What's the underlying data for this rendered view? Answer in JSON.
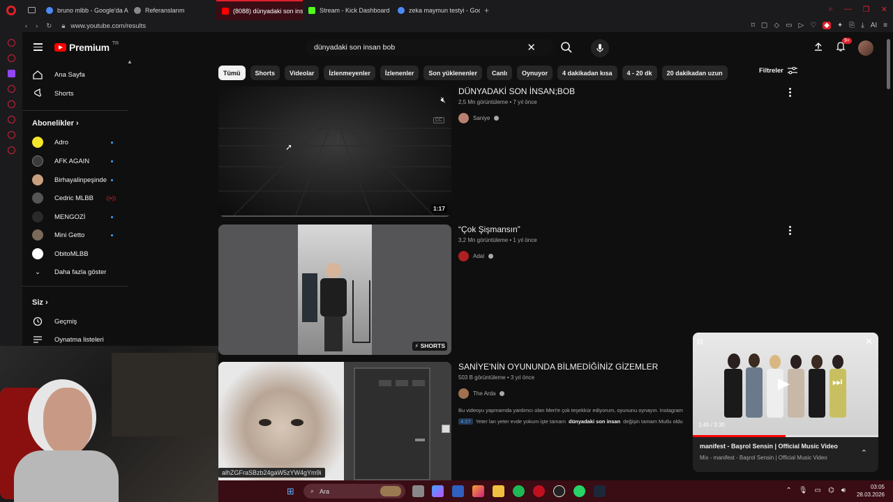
{
  "browser": {
    "tabs": [
      {
        "label": "bruno mlbb - Google'da A",
        "color": "#4a8af4",
        "active": false
      },
      {
        "label": "Referanslarım",
        "color": "#bbbbbb",
        "active": false
      },
      {
        "label": "(8088) dünyadaki son insa",
        "color": "#ff0000",
        "active": true
      },
      {
        "label": "Stream - Kick Dashboard",
        "color": "#53fc18",
        "active": false
      },
      {
        "label": "zeka maymun testyi - Goo",
        "color": "#4a8af4",
        "active": false
      }
    ],
    "new_tab": "+",
    "url": "www.youtube.com/results"
  },
  "yt": {
    "logo_text": "Premium",
    "logo_region": "TR",
    "search_value": "dünyadaki son insan bob",
    "notif_badge": "9+"
  },
  "sidebar": {
    "items_main": [
      {
        "label": "Ana Sayfa",
        "icon": "home-icon"
      },
      {
        "label": "Shorts",
        "icon": "shorts-icon"
      }
    ],
    "subs_title": "Abonelikler",
    "subs": [
      {
        "label": "Adro",
        "color": "#f5e62a",
        "state": "dot"
      },
      {
        "label": "AFK AGAIN",
        "color": "#3b3b3b",
        "state": "dot"
      },
      {
        "label": "Birhayalinpeşinde",
        "color": "#c8a080",
        "state": "dot"
      },
      {
        "label": "Cedric MLBB",
        "color": "#555555",
        "state": "live"
      },
      {
        "label": "MENGOZİ",
        "color": "#2a2a2a",
        "state": "dot"
      },
      {
        "label": "Mini Getto",
        "color": "#7a6a5a",
        "state": "dot"
      },
      {
        "label": "ObitoMLBB",
        "color": "#ffffff",
        "state": "none"
      }
    ],
    "show_more": "Daha fazla göster",
    "you_title": "Siz",
    "you_items": [
      {
        "label": "Geçmiş",
        "icon": "history-icon"
      },
      {
        "label": "Oynatma listeleri",
        "icon": "playlist-icon"
      }
    ]
  },
  "chips": [
    "Tümü",
    "Shorts",
    "Videolar",
    "İzlenmeyenler",
    "İzlenenler",
    "Son yüklenenler",
    "Canlı",
    "Oynuyor",
    "4 dakikadan kısa",
    "4 - 20 dk",
    "20 dakikadan uzun"
  ],
  "filters_label": "Filtreler",
  "results": [
    {
      "title": "DÜNYADAKİ SON İNSAN;BOB",
      "meta": "2,5 Mn görüntüleme • 7 yıl önce",
      "channel": "Saniye",
      "duration": "1:17",
      "cc": "CC"
    },
    {
      "title": "“Çok Şişmansın”",
      "meta": "3,2 Mn görüntüleme • 1 yıl önce",
      "channel": "Adal",
      "badge": "SHORTS"
    },
    {
      "title": "SANİYE'NİN OYUNUNDA BİLMEDİĞİNİZ GİZEMLER",
      "meta": "503 B görüntüleme • 3 yıl önce",
      "channel": "The Arda",
      "desc": "Bu videoyu yapmamda yardımcı olan Mert'e çok teşekkür ediyorum, oyununu oynayın. Instagram",
      "chapter_ts": "4:27",
      "chapter_pre": "Yeter lan yeter evde yokum işte tamam",
      "chapter_bold": "dünyadaki son insan",
      "chapter_post": "değişin tamam Mutlu oldu"
    }
  ],
  "miniplayer": {
    "title": "manifest - Başrol Sensin | Official Music Video",
    "subtitle": "Mix - manifest - Başrol Sensin | Official Music Video",
    "time": "1:45 / 3:30",
    "progress": 0.5
  },
  "hover_url": "alhZGFraSBzb24gaW5zYW4gYm9i",
  "taskbar": {
    "search_label": "Ara",
    "time": "03:05",
    "date": "28.03.2026"
  }
}
